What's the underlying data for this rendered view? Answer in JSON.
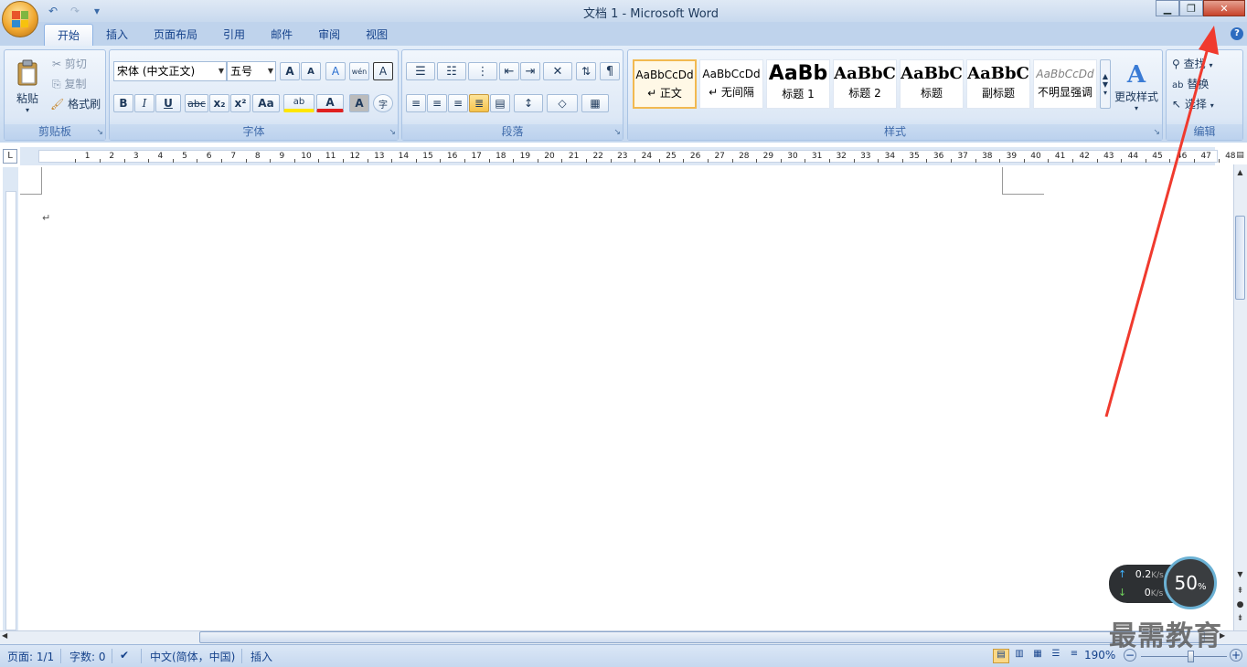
{
  "window": {
    "title": "文档 1 - Microsoft Word",
    "minimize": "▁",
    "restore": "❐",
    "close": "✕"
  },
  "qat": {
    "undo": "↶",
    "redo": "↷",
    "customize": "▾"
  },
  "tabs": [
    "开始",
    "插入",
    "页面布局",
    "引用",
    "邮件",
    "审阅",
    "视图"
  ],
  "active_tab": "开始",
  "help": "?",
  "clipboard": {
    "paste": "粘贴",
    "cut": "剪切",
    "copy": "复制",
    "format_painter": "格式刷",
    "label": "剪贴板"
  },
  "font": {
    "family": "宋体 (中文正文)",
    "size": "五号",
    "grow": "A",
    "shrink": "A",
    "clear": "A",
    "phonetic": "wén",
    "border": "A",
    "bold": "B",
    "italic": "I",
    "underline": "U",
    "strike": "abc",
    "sub": "x₂",
    "sup": "x²",
    "case": "Aa",
    "highlight": "ab",
    "color": "A",
    "shade": "A",
    "enclose": "字",
    "label": "字体"
  },
  "paragraph": {
    "label": "段落"
  },
  "styles": {
    "items": [
      {
        "preview": "AaBbCcDd",
        "name": "↵ 正文"
      },
      {
        "preview": "AaBbCcDd",
        "name": "↵ 无间隔"
      },
      {
        "preview": "AaBb",
        "name": "标题 1"
      },
      {
        "preview": "AaBbC",
        "name": "标题 2"
      },
      {
        "preview": "AaBbC",
        "name": "标题"
      },
      {
        "preview": "AaBbC",
        "name": "副标题"
      },
      {
        "preview": "AaBbCcDd",
        "name": "不明显强调"
      }
    ],
    "change": "更改样式",
    "label": "样式"
  },
  "editing": {
    "find": "查找",
    "replace": "替换",
    "select": "选择",
    "label": "编辑"
  },
  "ruler": {
    "corner": "L",
    "numbers": [
      "1",
      "2",
      "3",
      "4",
      "5",
      "6",
      "7",
      "8",
      "9",
      "10",
      "11",
      "12",
      "13",
      "14",
      "15",
      "16",
      "17",
      "18",
      "19",
      "20",
      "21",
      "22",
      "23",
      "24",
      "25",
      "26",
      "27",
      "28",
      "29",
      "30",
      "31",
      "32",
      "33",
      "34",
      "35",
      "36",
      "37",
      "38",
      "39",
      "40",
      "41",
      "42",
      "43",
      "44",
      "45",
      "46",
      "47",
      "48"
    ]
  },
  "document": {
    "paragraph_mark": "↵"
  },
  "status": {
    "page": "页面: 1/1",
    "words": "字数: 0",
    "language": "中文(简体，中国)",
    "mode": "插入",
    "zoom": "190%"
  },
  "net_widget": {
    "up": "0.2",
    "up_unit": "K/s",
    "down": "0",
    "down_unit": "K/s",
    "percent": "50",
    "percent_unit": "%"
  },
  "watermark": "最需教育",
  "colors": {
    "accent": "#15428b",
    "annotation_arrow": "#f03a2e",
    "close_button": "#c7432b"
  }
}
